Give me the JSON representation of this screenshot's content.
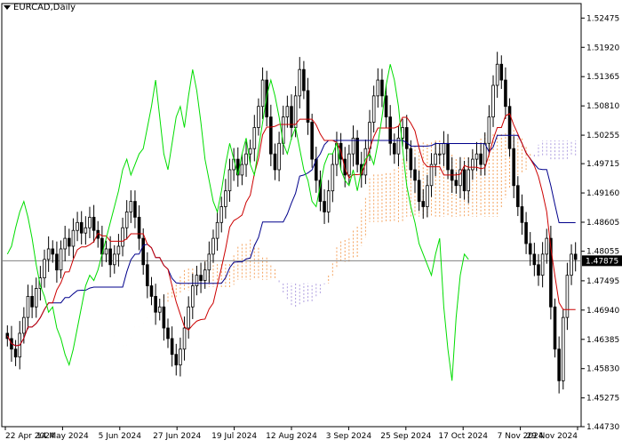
{
  "symbol_label": "EURCAD,Daily",
  "chart_data": {
    "type": "candlestick",
    "title": "EURCAD,Daily",
    "x_ticks": [
      "22 Apr 2024",
      "14 May 2024",
      "5 Jun 2024",
      "27 Jun 2024",
      "19 Jul 2024",
      "12 Aug 2024",
      "3 Sep 2024",
      "25 Sep 2024",
      "17 Oct 2024",
      "7 Nov 2024",
      "29 Nov 2024"
    ],
    "y_ticks": [
      "1.52475",
      "1.51920",
      "1.51365",
      "1.50810",
      "1.50255",
      "1.49715",
      "1.49160",
      "1.48605",
      "1.48055",
      "1.47495",
      "1.46940",
      "1.46385",
      "1.45830",
      "1.45275",
      "1.44730"
    ],
    "ylim": [
      1.4473,
      1.5275
    ],
    "current_price": "1.47875",
    "colors": {
      "bull_body": "#ffffff",
      "bear_body": "#000000",
      "kijun": "#00008b",
      "tenkan": "#cc0000",
      "chikou": "#00dd00",
      "cloud_bull": "#f4a460",
      "cloud_bear": "#b0a0e0",
      "grid": "#000000",
      "price_line": "#808080",
      "price_label_bg": "#000000",
      "price_label_text": "#ffffff"
    },
    "close": [
      1.464,
      1.462,
      1.4605,
      1.465,
      1.468,
      1.472,
      1.47,
      1.4735,
      1.4755,
      1.479,
      1.481,
      1.48,
      1.477,
      1.481,
      1.483,
      1.4815,
      1.4845,
      1.486,
      1.484,
      1.485,
      1.487,
      1.4845,
      1.483,
      1.48,
      1.481,
      1.478,
      1.48,
      1.4815,
      1.485,
      1.488,
      1.49,
      1.487,
      1.483,
      1.478,
      1.474,
      1.472,
      1.469,
      1.47,
      1.466,
      1.464,
      1.461,
      1.459,
      1.462,
      1.466,
      1.47,
      1.474,
      1.476,
      1.475,
      1.477,
      1.48,
      1.483,
      1.486,
      1.489,
      1.492,
      1.496,
      1.498,
      1.495,
      1.497,
      1.499,
      1.5,
      1.504,
      1.508,
      1.513,
      1.506,
      1.499,
      1.496,
      1.501,
      1.506,
      1.508,
      1.504,
      1.51,
      1.515,
      1.511,
      1.505,
      1.498,
      1.494,
      1.49,
      1.488,
      1.492,
      1.497,
      1.501,
      1.498,
      1.495,
      1.499,
      1.502,
      1.497,
      1.495,
      1.5,
      1.505,
      1.51,
      1.513,
      1.51,
      1.506,
      1.501,
      1.499,
      1.502,
      1.504,
      1.5,
      1.496,
      1.494,
      1.49,
      1.489,
      1.493,
      1.497,
      1.499,
      1.499,
      1.501,
      1.496,
      1.494,
      1.493,
      1.496,
      1.492,
      1.496,
      1.498,
      1.499,
      1.497,
      1.501,
      1.506,
      1.512,
      1.516,
      1.513,
      1.508,
      1.5,
      1.493,
      1.489,
      1.486,
      1.482,
      1.48,
      1.478,
      1.476,
      1.48,
      1.483,
      1.47,
      1.462,
      1.456,
      1.468,
      1.476,
      1.48,
      1.479
    ]
  }
}
